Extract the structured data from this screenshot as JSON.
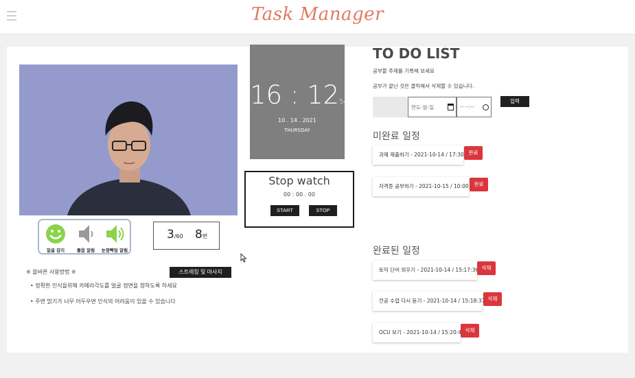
{
  "app": {
    "title": "Task Manager"
  },
  "camera": {
    "status": {
      "face": "얼굴 감지",
      "sound": "졸음 알림",
      "blink": "눈깜빡임 알림"
    },
    "counter": {
      "value1": "3",
      "unit1": "/60",
      "value2": "8",
      "unit2": "번"
    }
  },
  "usage": {
    "title": "※ 올바른 사용방법 ※",
    "lines": [
      "• 정확한 인식을위해 카메라각도를 얼굴 정면을 향하도록 하세요",
      "• 주변 밝기가 너무 어두우면 인식의 어려움이 있을 수 있습니다"
    ],
    "stretch_button": "스트레칭 및 마사지"
  },
  "clock": {
    "hours": "16",
    "minutes": "12",
    "seconds": "54",
    "date": "10 . 14 . 2021",
    "day": "THURSDAY"
  },
  "stopwatch": {
    "title": "Stop watch",
    "time": "00 : 00 . 00",
    "start": "START",
    "stop": "STOP"
  },
  "todo": {
    "title": "TO DO LIST",
    "subtitle1": "공부할 주제를 기록해 보세요",
    "subtitle2": "공부가 끝난 것은 클릭해서 삭제할 수 있습니다.",
    "date_placeholder": "연도-월-일",
    "time_placeholder": "-- --:--",
    "submit": "입력",
    "pending_heading": "미완료 일정",
    "pending": [
      {
        "text": "과제 제출하기 - 2021-10-14 / 17:30",
        "action": "완료"
      },
      {
        "text": "자격증 공부하기 - 2021-10-15 / 10:00",
        "action": "완료"
      }
    ],
    "done_heading": "완료된 일정",
    "done": [
      {
        "text": "토익 단어 외우기 - 2021-10-14 / 15:17:36",
        "action": "삭제"
      },
      {
        "text": "전공 수업 다시 듣기 - 2021-10-14 / 15:18:37",
        "action": "삭제"
      },
      {
        "text": "OCU 보기 - 2021-10-14 / 15:20:42",
        "action": "삭제"
      }
    ]
  },
  "colors": {
    "brand": "#e07a5f",
    "danger": "#d9363e",
    "clock_bg": "#7f7f7f",
    "camera_bg": "#8f97c9",
    "face_ok": "#8bd34a"
  }
}
